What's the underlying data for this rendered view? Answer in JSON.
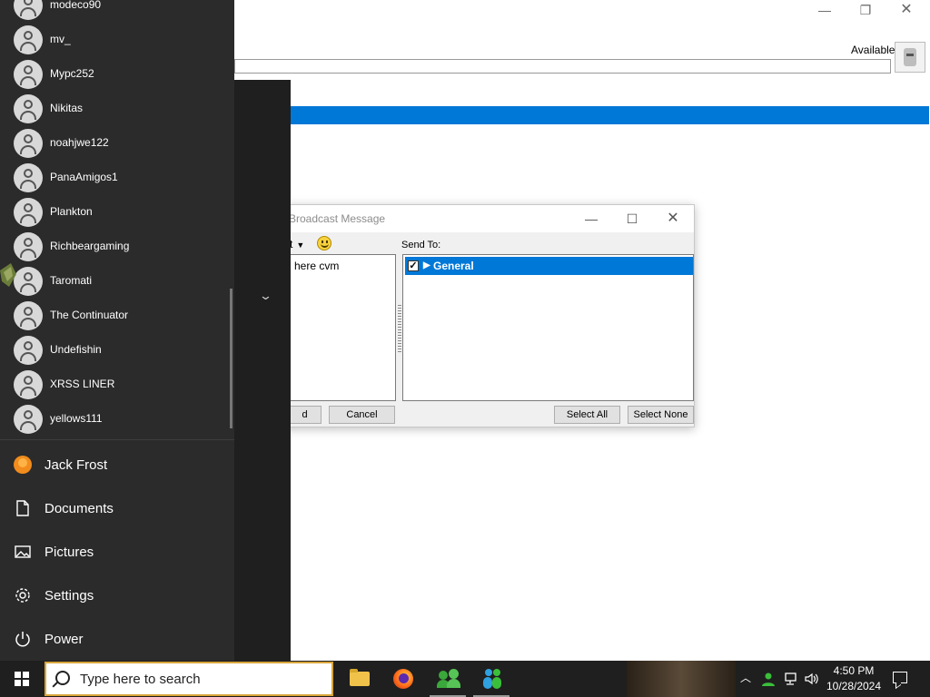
{
  "background_app": {
    "status": "Available",
    "min_glyph": "—",
    "max_glyph": "❐",
    "close_glyph": "✕",
    "chevron_glyph": "⌄"
  },
  "dialog": {
    "title": "Broadcast Message",
    "min_glyph": "—",
    "max_glyph": "☐",
    "close_glyph": "✕",
    "format_label": "t",
    "format_caret": "▼",
    "message_text": "here cvm",
    "send_to_label": "Send To:",
    "recipients": [
      {
        "label": "General",
        "checked": true,
        "check_glyph": "✓",
        "expand_glyph": "▶"
      }
    ],
    "buttons": {
      "send": "d",
      "cancel": "Cancel",
      "select_all": "Select All",
      "select_none": "Select None"
    }
  },
  "start_menu": {
    "users": [
      {
        "name": "modeco90"
      },
      {
        "name": "mv_"
      },
      {
        "name": "Mypc252"
      },
      {
        "name": "Nikitas"
      },
      {
        "name": "noahjwe122"
      },
      {
        "name": "PanaAmigos1"
      },
      {
        "name": "Plankton"
      },
      {
        "name": "Richbeargaming"
      },
      {
        "name": "Taromati"
      },
      {
        "name": "The Continuator"
      },
      {
        "name": "Undefishin"
      },
      {
        "name": "XRSS LINER"
      },
      {
        "name": "yellows111"
      }
    ],
    "current_user": "Jack Frost",
    "items": [
      {
        "label": "Documents",
        "icon": "document-icon"
      },
      {
        "label": "Pictures",
        "icon": "pictures-icon"
      },
      {
        "label": "Settings",
        "icon": "gear-icon"
      },
      {
        "label": "Power",
        "icon": "power-icon"
      }
    ]
  },
  "taskbar": {
    "search_placeholder": "Type here to search",
    "apps": [
      "File Explorer",
      "Firefox",
      "Contacts",
      "Messenger"
    ],
    "tray_up_glyph": "︿",
    "time": "4:50 PM",
    "date": "10/28/2024"
  },
  "colors": {
    "accent": "#0078d7",
    "start_menu_bg": "#2b2b2b",
    "taskbar_bg": "#1f1f1f"
  }
}
